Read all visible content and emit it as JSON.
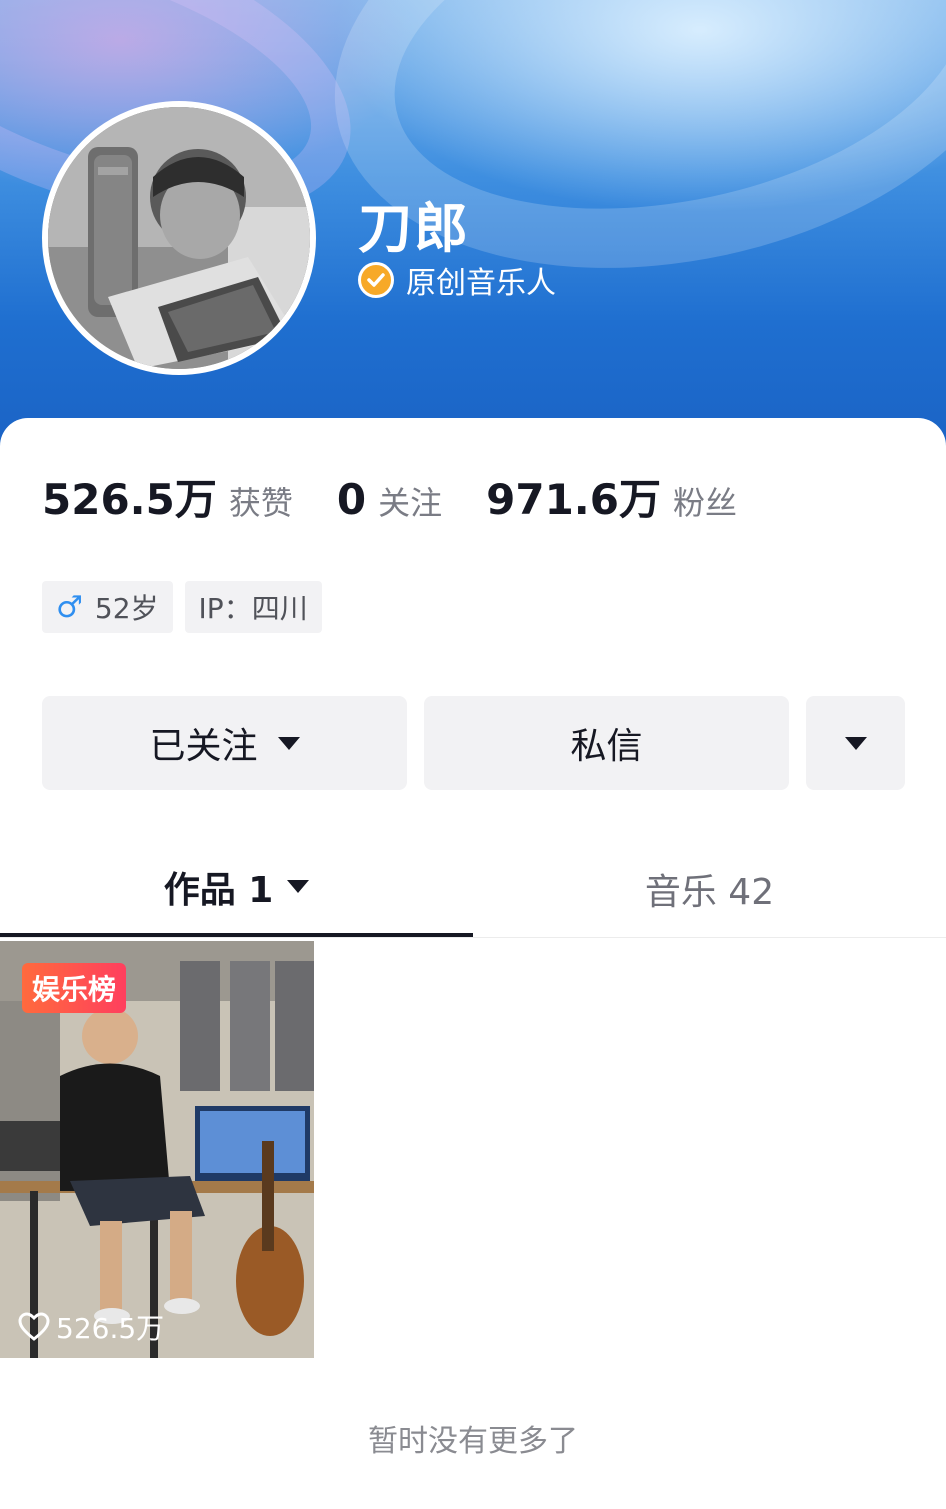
{
  "profile": {
    "name": "刀郎",
    "verified_label": "原创音乐人"
  },
  "stats": [
    {
      "value": "526.5万",
      "label": "获赞"
    },
    {
      "value": "0",
      "label": "关注"
    },
    {
      "value": "971.6万",
      "label": "粉丝"
    }
  ],
  "tags": {
    "age": "52岁",
    "ip": "IP：四川"
  },
  "actions": {
    "follow_label": "已关注",
    "message_label": "私信"
  },
  "tabs": [
    {
      "label": "作品 1"
    },
    {
      "label": "音乐 42"
    }
  ],
  "videos": [
    {
      "badge": "娱乐榜",
      "likes": "526.5万"
    }
  ],
  "end_note": "暂时没有更多了",
  "colors": {
    "banner_blue": "#1f6fd0",
    "verified_badge": "#f7a928",
    "tag_male": "#2f8ff0",
    "badge_red": "#ff3f5e"
  }
}
